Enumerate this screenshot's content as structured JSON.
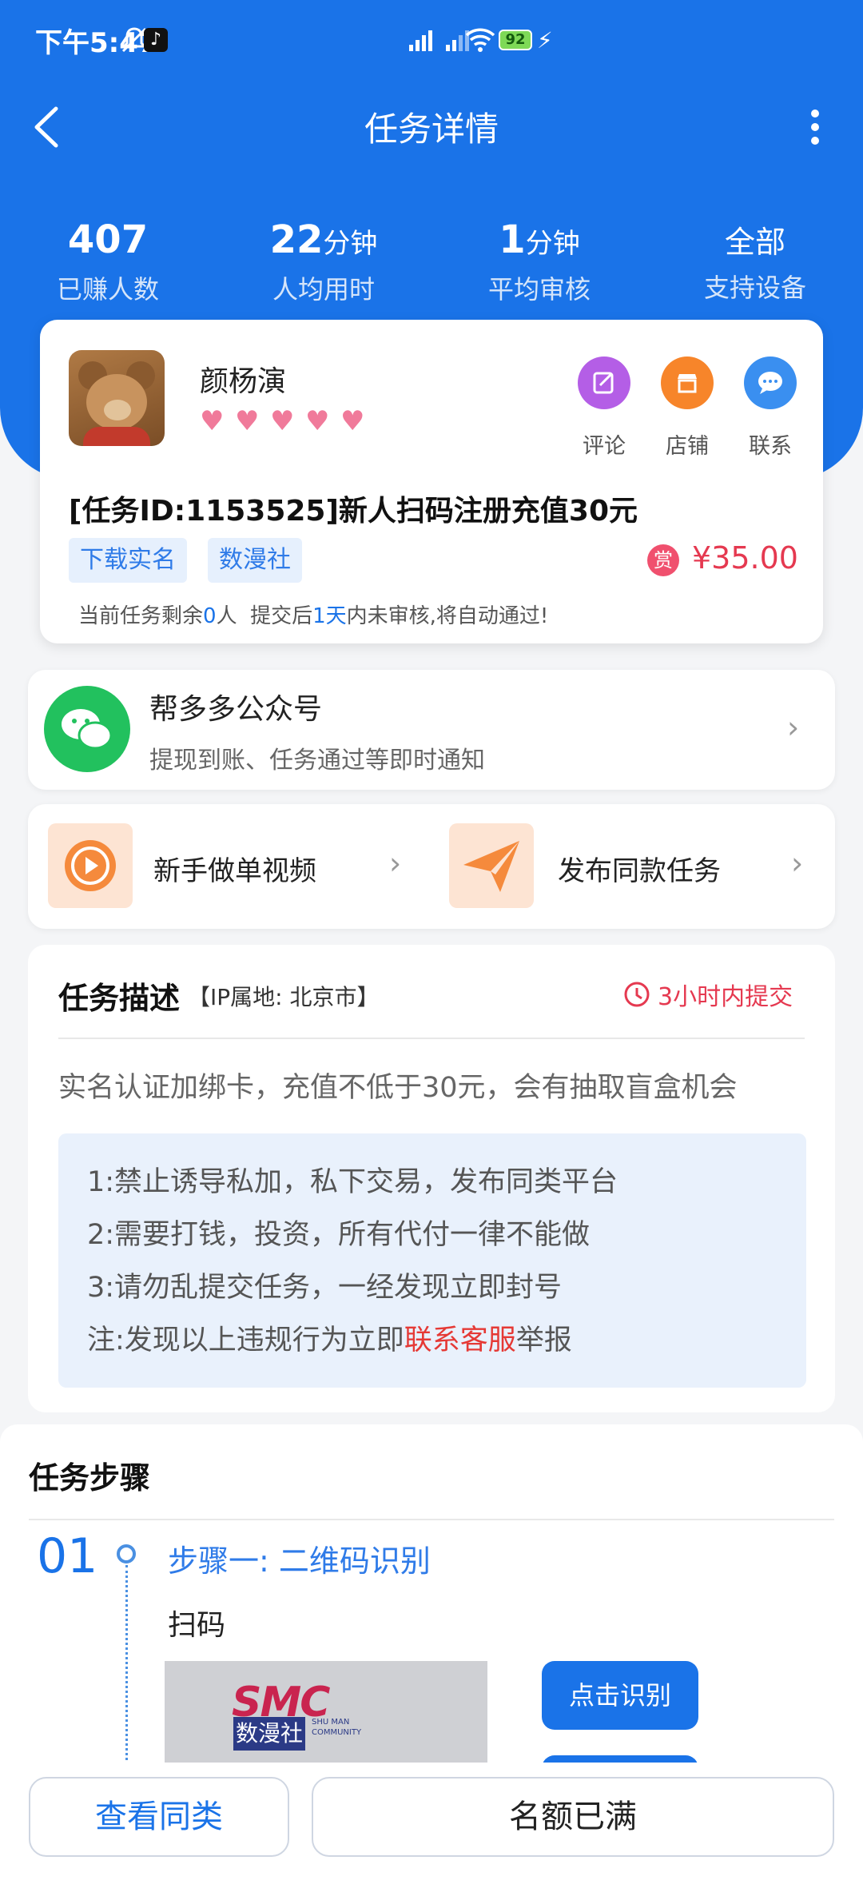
{
  "status_bar": {
    "time": "下午5:47",
    "battery": "92"
  },
  "nav": {
    "title": "任务详情"
  },
  "stats": [
    {
      "value": "407",
      "unit": "",
      "label": "已赚人数"
    },
    {
      "value": "22",
      "unit": "分钟",
      "label": "人均用时"
    },
    {
      "value": "1",
      "unit": "分钟",
      "label": "平均审核"
    },
    {
      "value": "",
      "unit": "全部",
      "label": "支持设备"
    }
  ],
  "task": {
    "publisher": "颜杨演",
    "hearts": 5,
    "actions": [
      {
        "label": "评论",
        "icon": "edit-icon",
        "color": "#b45ee6"
      },
      {
        "label": "店铺",
        "icon": "store-icon",
        "color": "#f7852a"
      },
      {
        "label": "联系",
        "icon": "chat-icon",
        "color": "#3a8ff0"
      }
    ],
    "title": "[任务ID:1153525]新人扫码注册充值30元",
    "tags": [
      "下载实名",
      "数漫社"
    ],
    "reward_badge": "赏",
    "reward": "¥35.00",
    "remaining_prefix": "当前任务剩余",
    "remaining_count": "0",
    "remaining_mid": "人  提交后",
    "review_days": "1天",
    "remaining_suffix": "内未审核,将自动通过!"
  },
  "wechat": {
    "title": "帮多多公众号",
    "subtitle": "提现到账、任务通过等即时通知"
  },
  "quick": {
    "video_label": "新手做单视频",
    "publish_label": "发布同款任务"
  },
  "description": {
    "title": "任务描述",
    "ip": "【IP属地: 北京市】",
    "deadline": "3小时内提交",
    "text": "实名认证加绑卡，充值不低于30元，会有抽取盲盒机会",
    "rules": [
      "1:禁止诱导私加，私下交易，发布同类平台",
      "2:需要打钱，投资，所有代付一律不能做",
      "3:请勿乱提交任务，一经发现立即封号"
    ],
    "note_prefix": "注:发现以上违规行为立即",
    "note_link": "联系客服",
    "note_suffix": "举报"
  },
  "steps": {
    "title": "任务步骤",
    "step_number": "01",
    "step_title": "步骤一: 二维码识别",
    "step_text": "扫码",
    "qr_button": "点击识别",
    "image_logo": "SMC",
    "image_brand": "数漫社",
    "image_sub": "SHU MAN COMMUNITY"
  },
  "bottom": {
    "similar_label": "查看同类",
    "full_label": "名额已满"
  },
  "colors": {
    "primary": "#1a73e8",
    "reward": "#e53950",
    "link_red": "#e53935"
  }
}
